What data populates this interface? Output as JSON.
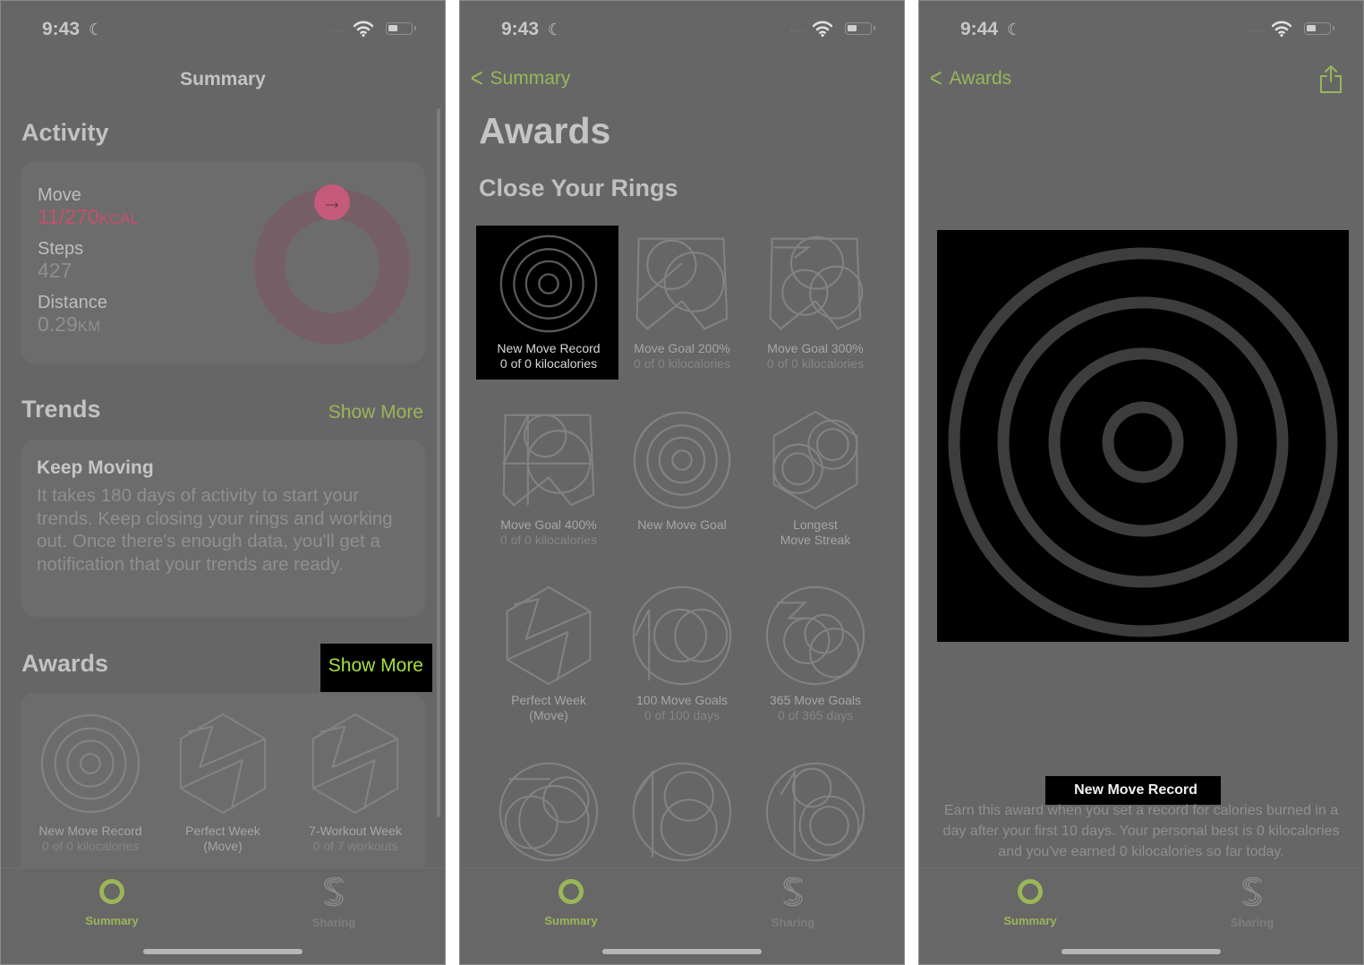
{
  "colors": {
    "accent_green": "#9ab657",
    "move_pink": "#c4516e",
    "background": "#666666",
    "highlight": "#000000"
  },
  "screens": [
    {
      "status": {
        "time": "9:43",
        "focus_icon": "moon-icon"
      },
      "nav_title": "Summary",
      "activity": {
        "title": "Activity",
        "move_label": "Move",
        "move_value": "11/270",
        "move_unit": "KCAL",
        "move_progress_fraction": 0.04,
        "steps_label": "Steps",
        "steps_value": "427",
        "distance_label": "Distance",
        "distance_value": "0.29",
        "distance_unit": "KM"
      },
      "trends": {
        "title": "Trends",
        "show_more": "Show More",
        "card_title": "Keep Moving",
        "card_body": "It takes 180 days of activity to start your trends. Keep closing your rings and working out. Once there's enough data, you'll get a notification that your trends are ready."
      },
      "awards": {
        "title": "Awards",
        "show_more": "Show More",
        "items": [
          {
            "name": "New Move Record",
            "progress": "0 of 0 kilocalories",
            "icon": "target-rings-icon"
          },
          {
            "name": "Perfect Week",
            "progress": "(Move)",
            "icon": "hexagon-7-icon"
          },
          {
            "name": "7-Workout Week",
            "progress": "0 of 7 workouts",
            "icon": "hexagon-7-icon"
          }
        ]
      },
      "tabs": [
        {
          "label": "Summary",
          "icon": "activity-ring-icon",
          "active": true
        },
        {
          "label": "Sharing",
          "icon": "sharing-s-icon",
          "active": false
        }
      ]
    },
    {
      "status": {
        "time": "9:43",
        "focus_icon": "moon-icon"
      },
      "back_label": "Summary",
      "title": "Awards",
      "section": "Close Your Rings",
      "awards": [
        {
          "name": "New Move Record",
          "progress": "0 of 0 kilocalories",
          "selected": true
        },
        {
          "name": "Move Goal 200%",
          "progress": "0 of 0 kilocalories"
        },
        {
          "name": "Move Goal 300%",
          "progress": "0 of 0 kilocalories"
        },
        {
          "name": "Move Goal 400%",
          "progress": "0 of 0 kilocalories"
        },
        {
          "name": "New Move Goal",
          "progress": ""
        },
        {
          "name": "Longest",
          "progress": "Move Streak"
        },
        {
          "name": "Perfect Week",
          "progress": "(Move)"
        },
        {
          "name": "100 Move Goals",
          "progress": "0 of 100 days"
        },
        {
          "name": "365 Move Goals",
          "progress": "0 of 365 days"
        }
      ],
      "tabs": [
        {
          "label": "Summary",
          "active": true
        },
        {
          "label": "Sharing",
          "active": false
        }
      ]
    },
    {
      "status": {
        "time": "9:44",
        "focus_icon": "moon-icon"
      },
      "back_label": "Awards",
      "share_icon": "share-icon",
      "award_name": "New Move Record",
      "award_description": "Earn this award when you set a record for calories burned in a day after your first 10 days. Your personal best is 0 kilocalories and you've earned 0 kilocalories so far today.",
      "tabs": [
        {
          "label": "Summary",
          "active": true
        },
        {
          "label": "Sharing",
          "active": false
        }
      ]
    }
  ]
}
